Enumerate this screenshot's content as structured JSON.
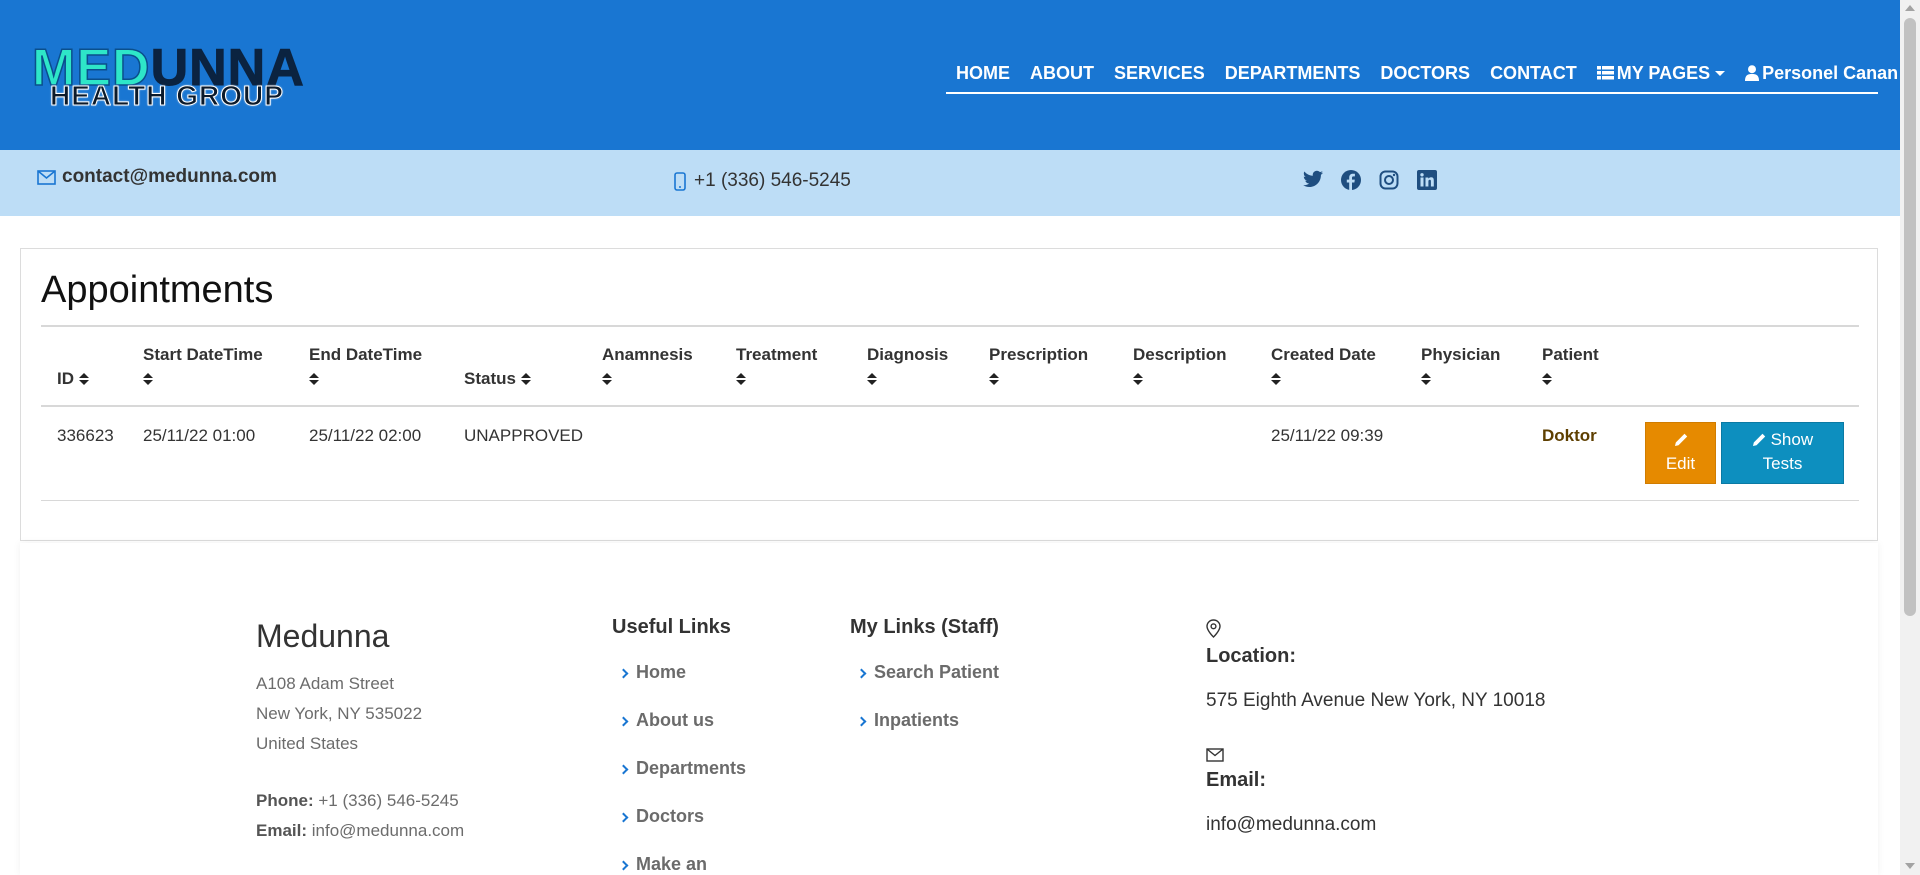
{
  "logo": {
    "line1_a": "MED",
    "line1_b": "UNNA",
    "line2": "HEALTH GROUP"
  },
  "nav": {
    "home": "HOME",
    "about": "ABOUT",
    "services": "SERVICES",
    "departments": "DEPARTMENTS",
    "doctors": "DOCTORS",
    "contact": "CONTACT",
    "my_pages": "MY PAGES",
    "user": "Personel Canan"
  },
  "strip": {
    "email": "contact@medunna.com",
    "phone": "+1 (336) 546-5245",
    "social": [
      "twitter-icon",
      "facebook-icon",
      "instagram-icon",
      "linkedin-icon"
    ]
  },
  "appointments": {
    "title": "Appointments",
    "headers": {
      "id": "ID",
      "start": "Start DateTime",
      "end": "End DateTime",
      "status": "Status",
      "anamnesis": "Anamnesis",
      "treatment": "Treatment",
      "diagnosis": "Diagnosis",
      "prescription": "Prescription",
      "description": "Description",
      "created": "Created Date",
      "physician": "Physician",
      "patient": "Patient"
    },
    "rows": [
      {
        "id": "336623",
        "start": "25/11/22 01:00",
        "end": "25/11/22 02:00",
        "status": "UNAPPROVED",
        "anamnesis": "",
        "treatment": "",
        "diagnosis": "",
        "prescription": "",
        "description": "",
        "created": "25/11/22 09:39",
        "physician": "",
        "patient": "Doktor",
        "edit_label": "Edit",
        "show_label_1": "Show",
        "show_label_2": "Tests"
      }
    ]
  },
  "footer": {
    "brand": "Medunna",
    "address": [
      "A108 Adam Street",
      "New York, NY 535022",
      "United States"
    ],
    "phone_label": "Phone:",
    "phone": "+1 (336) 546-5245",
    "email_label": "Email:",
    "email": "info@medunna.com",
    "useful_links_title": "Useful Links",
    "useful_links": [
      "Home",
      "About us",
      "Departments",
      "Doctors",
      "Make an"
    ],
    "staff_links_title": "My Links (Staff)",
    "staff_links": [
      "Search Patient",
      "Inpatients"
    ],
    "location_label": "Location:",
    "location": "575 Eighth Avenue New York, NY 10018",
    "email2_label": "Email:",
    "email2": "info@medunna.com"
  },
  "colors": {
    "header_bg": "#1976d2",
    "strip_bg": "#bdddf6",
    "edit_button": "#e68a00",
    "show_button": "#0d8fbf",
    "patient_text": "#5e3f00"
  }
}
